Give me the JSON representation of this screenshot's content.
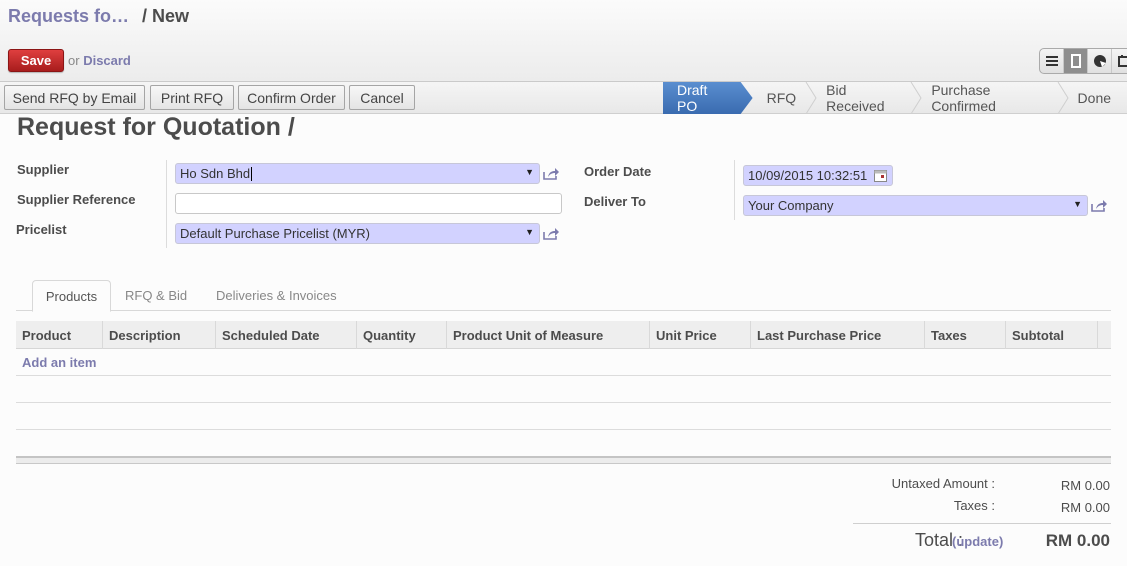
{
  "header": {
    "breadcrumb_parent": "Requests fo…",
    "breadcrumb_current": "/ New",
    "save_label": "Save",
    "or_label": "or",
    "discard_label": "Discard",
    "view_switch": [
      {
        "icon": "list-view-icon",
        "glyph": "≡",
        "active": false
      },
      {
        "icon": "form-view-icon",
        "glyph": "▯",
        "active": true
      },
      {
        "icon": "graph-view-icon",
        "glyph": "◕",
        "active": false
      },
      {
        "icon": "calendar-view-icon",
        "glyph": "▭",
        "active": false
      }
    ]
  },
  "actions": {
    "send_rfq": "Send RFQ by Email",
    "print_rfq": "Print RFQ",
    "confirm_order": "Confirm Order",
    "cancel": "Cancel"
  },
  "statusbar": {
    "stages": [
      "Draft PO",
      "RFQ",
      "Bid Received",
      "Purchase Confirmed",
      "Done"
    ],
    "active": "Draft PO",
    "accent_color": "#4a7cc0"
  },
  "form": {
    "title": "Request for Quotation /",
    "supplier_label": "Supplier",
    "supplier_value": "Ho Sdn Bhd",
    "supplier_reference_label": "Supplier Reference",
    "supplier_reference_value": "",
    "pricelist_label": "Pricelist",
    "pricelist_value": "Default Purchase Pricelist (MYR)",
    "order_date_label": "Order Date",
    "order_date_value": "10/09/2015 10:32:51",
    "deliver_to_label": "Deliver To",
    "deliver_to_value": "Your Company"
  },
  "tabs": [
    "Products",
    "RFQ & Bid",
    "Deliveries & Invoices"
  ],
  "active_tab": "Products",
  "lines": {
    "columns": [
      "Product",
      "Description",
      "Scheduled Date",
      "Quantity",
      "Product Unit of Measure",
      "Unit Price",
      "Last Purchase Price",
      "Taxes",
      "Subtotal"
    ],
    "add_item_label": "Add an item",
    "rows": []
  },
  "totals": {
    "untaxed_label": "Untaxed Amount :",
    "untaxed_value": "RM 0.00",
    "taxes_label": "Taxes :",
    "taxes_value": "RM 0.00",
    "total_label": "Total :",
    "update_label": "(update)",
    "total_value": "RM 0.00"
  }
}
